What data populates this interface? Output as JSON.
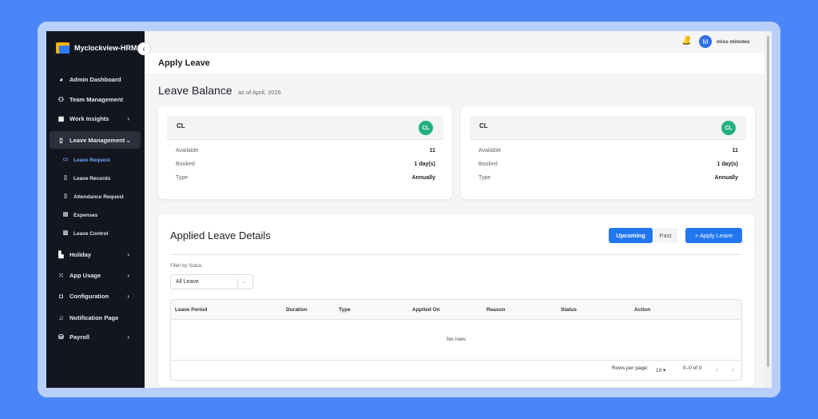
{
  "app": {
    "brand": "Myclockview-HRMS"
  },
  "sidebar": {
    "items": [
      {
        "label": "Admin Dashboard",
        "icon": "pie-chart-icon",
        "chevron": false
      },
      {
        "label": "Team Management",
        "icon": "team-icon",
        "chevron": false
      },
      {
        "label": "Work Insights",
        "icon": "dashboard-grid-icon",
        "chevron": true
      },
      {
        "label": "Leave Management",
        "icon": "cylinder-icon",
        "chevron": true,
        "expanded": true
      },
      {
        "label": "Holiday",
        "icon": "holiday-icon",
        "chevron": true
      },
      {
        "label": "App Usage",
        "icon": "apps-grid-icon",
        "chevron": true
      },
      {
        "label": "Configuration",
        "icon": "settings-box-icon",
        "chevron": true
      },
      {
        "label": "Notification Page",
        "icon": "bell-icon",
        "chevron": false
      },
      {
        "label": "Payroll",
        "icon": "payroll-icon",
        "chevron": true
      }
    ],
    "leave_subitems": [
      {
        "label": "Leave Request",
        "icon": "card-icon",
        "active": true
      },
      {
        "label": "Leave Records",
        "icon": "records-icon"
      },
      {
        "label": "Attendance Request",
        "icon": "cylinder-icon"
      },
      {
        "label": "Expenses",
        "icon": "receipt-icon"
      },
      {
        "label": "Leave Control",
        "icon": "control-icon"
      }
    ]
  },
  "topbar": {
    "user_initial": "M",
    "user_name": "miss minutes"
  },
  "page": {
    "title": "Apply Leave"
  },
  "leave_balance": {
    "title": "Leave Balance",
    "as_of": "as of April, 2026",
    "cards": [
      {
        "code": "CL",
        "badge": "CL",
        "available_label": "Available",
        "available": "11",
        "booked_label": "Booked",
        "booked": "1 day(s)",
        "type_label": "Type",
        "type": "Annually"
      },
      {
        "code": "CL",
        "badge": "CL",
        "available_label": "Available",
        "available": "11",
        "booked_label": "Booked",
        "booked": "1 day(s)",
        "type_label": "Type",
        "type": "Annually"
      }
    ]
  },
  "details": {
    "title": "Applied Leave Details",
    "tab_upcoming": "Upcoming",
    "tab_past": "Past",
    "apply_button": "+ Apply Leave",
    "filter_label": "Filter by Status",
    "filter_value": "All Leave",
    "columns": [
      "Leave Period",
      "Duration",
      "Type",
      "Applied On",
      "Reason",
      "Status",
      "Action"
    ],
    "empty_text": "No rows",
    "rows_per_page_label": "Rows per page:",
    "rows_per_page": "10",
    "range": "0–0 of 0"
  },
  "colors": {
    "accent": "#2277f0",
    "sidebar": "#14161f",
    "badge": "#22b07d",
    "background": "#4a86f7"
  }
}
